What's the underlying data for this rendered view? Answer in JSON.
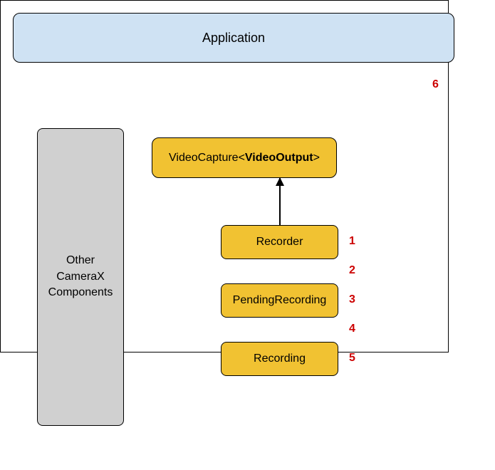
{
  "boxes": {
    "application": "Application",
    "otherCameraX": "Other\nCameraX\nComponents",
    "videoCapture": {
      "prefix": "VideoCapture<",
      "bold": "VideoOutput",
      "suffix": ">"
    },
    "recorder": "Recorder",
    "pendingRecording": "PendingRecording",
    "recording": "Recording"
  },
  "labels": {
    "num1": "1",
    "num2": "2",
    "num3": "3",
    "num4": "4",
    "num5": "5",
    "num6": "6"
  }
}
